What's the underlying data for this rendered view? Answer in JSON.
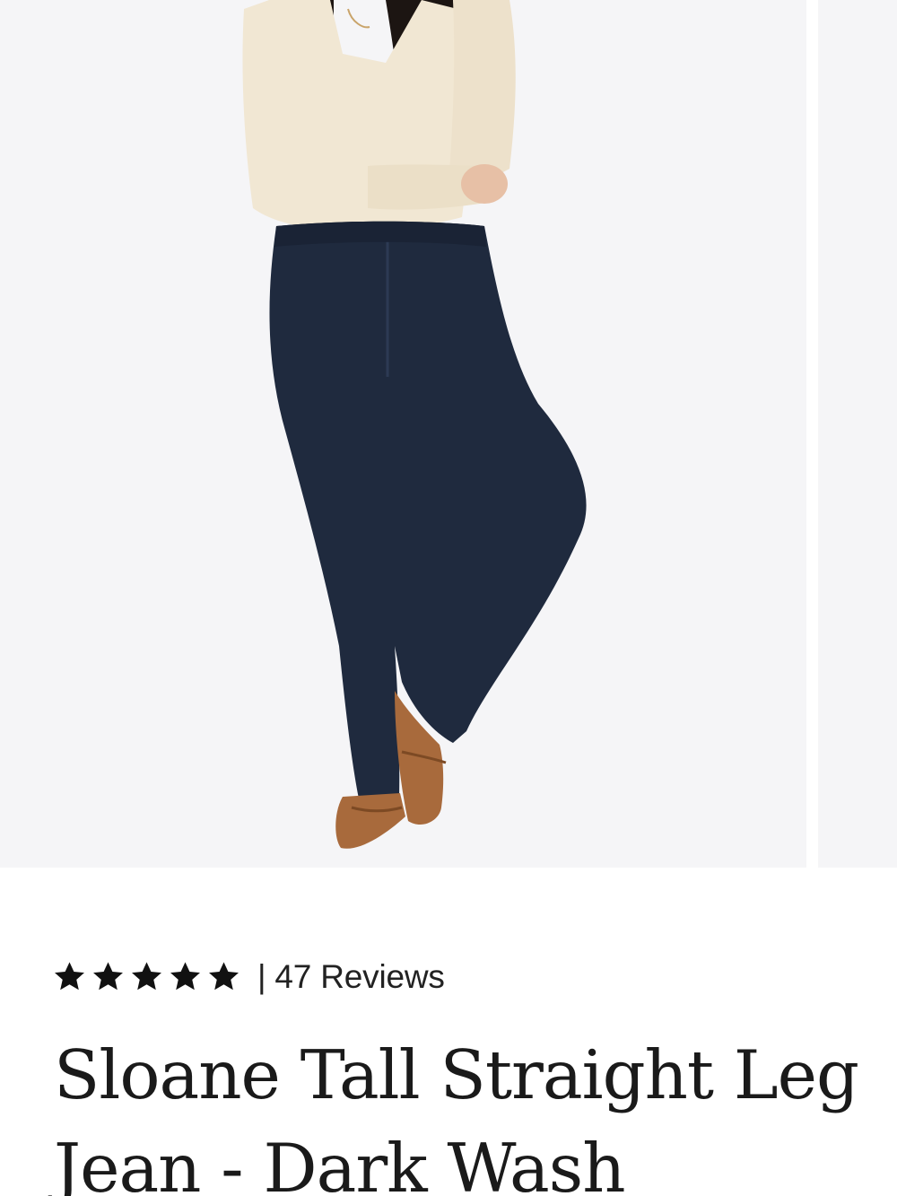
{
  "product": {
    "title": "Sloane Tall Straight Leg Jean - Dark Wash",
    "rating": {
      "stars": 5,
      "max_stars": 5,
      "separator": "|",
      "reviews_label": "47 Reviews"
    }
  },
  "colors": {
    "image_background": "#f5f5f7",
    "text": "#1a1a1a",
    "star": "#111111",
    "jeans": "#1f2a3e",
    "sweater": "#f1e7d3",
    "shoes": "#a86a3c",
    "hair": "#1c1512",
    "skin": "#e7c0a6"
  },
  "icons": {
    "star": "star-icon"
  }
}
